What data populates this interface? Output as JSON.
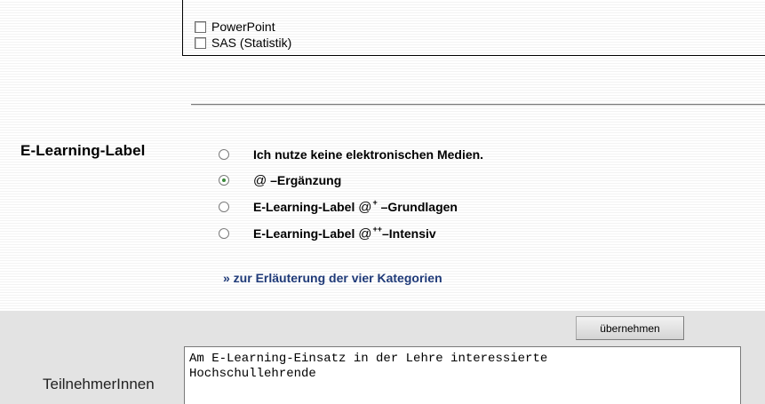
{
  "checkbox_list": {
    "items": [
      {
        "label": "PowerPoint",
        "checked": false
      },
      {
        "label": "SAS (Statistik)",
        "checked": false
      }
    ]
  },
  "elearning": {
    "label": "E-Learning-Label",
    "options": [
      {
        "text": "Ich nutze keine elektronischen Medien.",
        "checked": false
      },
      {
        "at": "@",
        "sup": "",
        "text": " –Ergänzung",
        "checked": true
      },
      {
        "prefix": "E-Learning-Label ",
        "at": "@",
        "sup": "+",
        "text": " –Grundlagen",
        "checked": false
      },
      {
        "prefix": "E-Learning-Label ",
        "at": "@",
        "sup": "++",
        "text": "–Intensiv",
        "checked": false
      }
    ],
    "link": "» zur Erläuterung der vier Kategorien"
  },
  "apply_button": "übernehmen",
  "participants": {
    "label": "TeilnehmerInnen",
    "value": "Am E-Learning-Einsatz in der Lehre interessierte\nHochschullehrende"
  }
}
